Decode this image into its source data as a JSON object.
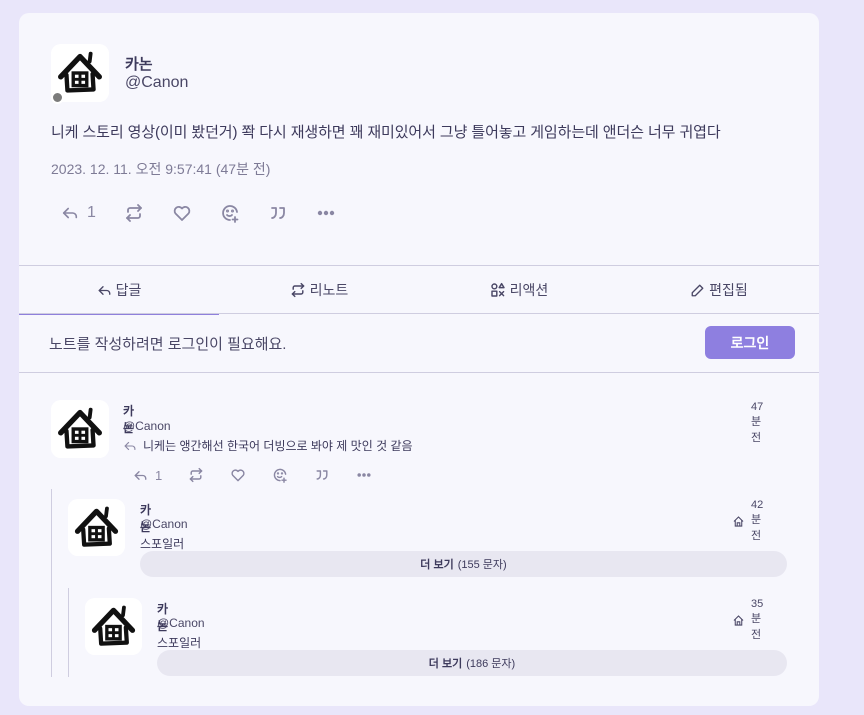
{
  "main_note": {
    "name": "카논",
    "handle": "@Canon",
    "text": "니케 스토리 영상(이미 봤던거) 쫙 다시 재생하면 꽤 재미있어서 그냥 틀어놓고 게임하는데 앤더슨 너무 귀엽다",
    "timestamp": "2023. 12. 11. 오전 9:57:41 (47분 전)",
    "reply_count": "1"
  },
  "tabs": [
    {
      "label": "답글",
      "icon": "reply-icon",
      "active": true
    },
    {
      "label": "리노트",
      "icon": "renote-icon"
    },
    {
      "label": "리액션",
      "icon": "reactions-icon"
    },
    {
      "label": "편집됨",
      "icon": "pencil-icon"
    }
  ],
  "login": {
    "prompt": "노트를 작성하려면 로그인이 필요해요.",
    "button": "로그인"
  },
  "replies": [
    {
      "name": "카논",
      "handle": "@Canon",
      "reply_to_text": "니케는 앵간해선 한국어 더빙으로 봐야 제 맛인 것 같음",
      "time": "47분 전",
      "reply_count": "1"
    },
    {
      "name": "카논",
      "handle": "@Canon",
      "text": "스포일러",
      "time": "42분 전",
      "visibility_icon": "home-icon",
      "more_label": "더 보기",
      "more_count": "(155 문자)"
    },
    {
      "name": "카논",
      "handle": "@Canon",
      "text": "스포일러",
      "time": "35분 전",
      "visibility_icon": "home-icon",
      "more_label": "더 보기",
      "more_count": "(186 문자)"
    }
  ],
  "colors": {
    "accent": "#8e7fe0",
    "background": "#e9e6fa",
    "card": "#f7f7fd"
  }
}
